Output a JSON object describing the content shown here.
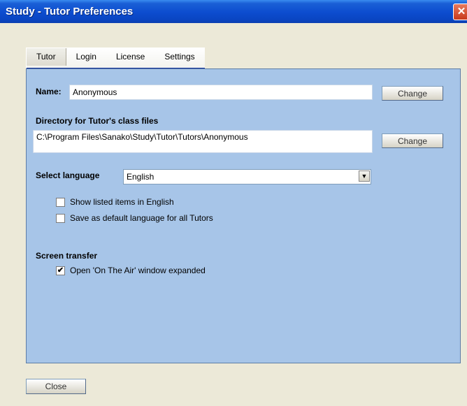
{
  "window": {
    "title": "Study - Tutor Preferences"
  },
  "tabs": [
    {
      "label": "Tutor",
      "active": true
    },
    {
      "label": "Login",
      "active": false
    },
    {
      "label": "License",
      "active": false
    },
    {
      "label": "Settings",
      "active": false
    }
  ],
  "name": {
    "label": "Name:",
    "value": "Anonymous",
    "change_label": "Change"
  },
  "directory": {
    "label": "Directory for Tutor's class files",
    "value": "C:\\Program Files\\Sanako\\Study\\Tutor\\Tutors\\Anonymous",
    "change_label": "Change"
  },
  "language": {
    "label": "Select language",
    "selected": "English",
    "options": [
      {
        "label": "Show listed items in English",
        "checked": false
      },
      {
        "label": "Save as default language for all Tutors",
        "checked": false
      }
    ]
  },
  "screen_transfer": {
    "label": "Screen transfer",
    "option": {
      "label": "Open 'On The Air' window expanded",
      "checked": true
    }
  },
  "footer": {
    "close_label": "Close"
  }
}
